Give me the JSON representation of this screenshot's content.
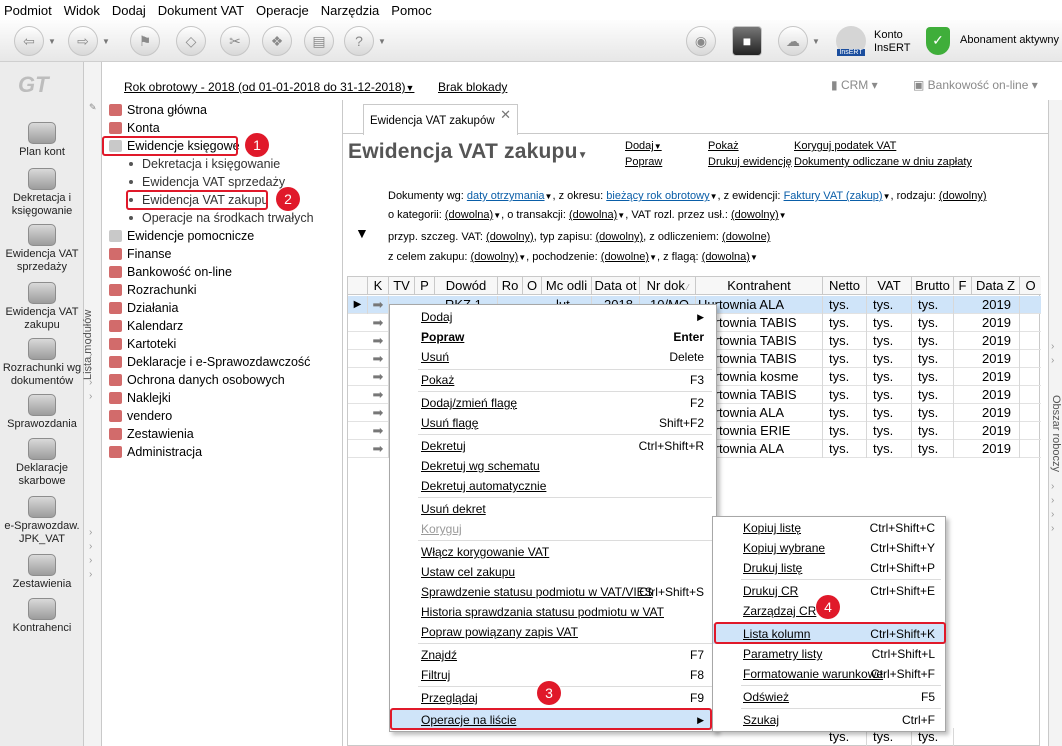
{
  "menubar": [
    "Podmiot",
    "Widok",
    "Dodaj",
    "Dokument VAT",
    "Operacje",
    "Narzędzia",
    "Pomoc"
  ],
  "toolbar": {
    "konto_line1": "Konto",
    "konto_line2": "InsERT",
    "abonament": "Abonament aktywny",
    "insert_logo": "InsERT"
  },
  "logo": "GT",
  "sidebar": [
    "Plan kont",
    "Dekretacja i księgowanie",
    "Ewidencja VAT sprzedaży",
    "Ewidencja VAT zakupu",
    "Rozrachunki wg dokumentów",
    "Sprawozdania",
    "Deklaracje skarbowe",
    "e-Sprawozdaw. JPK_VAT",
    "Zestawienia",
    "Kontrahenci"
  ],
  "lista_modulow": "Lista modułów",
  "yearbar": {
    "year": "Rok obrotowy - 2018  (od 01-01-2018 do 31-12-2018)",
    "blokada": "Brak blokady",
    "crm": "CRM",
    "bankowosc": "Bankowość on-line"
  },
  "tree": [
    {
      "label": "Strona główna"
    },
    {
      "label": "Konta"
    },
    {
      "label": "Ewidencje księgowe"
    },
    {
      "label": "Dekretacja i księgowanie"
    },
    {
      "label": "Ewidencja VAT sprzedaży"
    },
    {
      "label": "Ewidencja VAT zakupu"
    },
    {
      "label": "Operacje na środkach trwałych"
    },
    {
      "label": "Ewidencje pomocnicze"
    },
    {
      "label": "Finanse"
    },
    {
      "label": "Bankowość on-line"
    },
    {
      "label": "Rozrachunki"
    },
    {
      "label": "Działania"
    },
    {
      "label": "Kalendarz"
    },
    {
      "label": "Kartoteki"
    },
    {
      "label": "Deklaracje i e-Sprawozdawczość"
    },
    {
      "label": "Ochrona danych osobowych"
    },
    {
      "label": "Naklejki"
    },
    {
      "label": "vendero"
    },
    {
      "label": "Zestawienia"
    },
    {
      "label": "Administracja"
    }
  ],
  "tab_label": "Ewidencja VAT zakupów",
  "page_title": "Ewidencja VAT zakupu",
  "actions": {
    "dodaj": "Dodaj",
    "popraw": "Popraw",
    "pokaz": "Pokaż",
    "drukuj": "Drukuj ewidencję",
    "koryguj": "Koryguj podatek VAT",
    "dokumenty": "Dokumenty odliczane w dniu zapłaty"
  },
  "filters": {
    "l1_a": "Dokumenty wg:",
    "l1_b": "daty otrzymania",
    "l1_c": ", z okresu:",
    "l1_d": "bieżący rok obrotowy",
    "l1_e": ", z ewidencji:",
    "l1_f": "Faktury VAT (zakup)",
    "l1_g": ", rodzaju:",
    "l1_h": "(dowolny)",
    "l2_a": "o kategorii:",
    "l2_b": "(dowolna)",
    "l2_c": ", o transakcji:",
    "l2_d": "(dowolna)",
    "l2_e": ", VAT rozl. przez usł.:",
    "l2_f": "(dowolny)",
    "l3_a": "przyp. szczeg. VAT:",
    "l3_b": "(dowolny)",
    "l3_c": ", typ zapisu:",
    "l3_d": "(dowolny)",
    "l3_e": ", z odliczeniem:",
    "l3_f": "(dowolne)",
    "l4_a": "z celem zakupu:",
    "l4_b": "(dowolny)",
    "l4_c": ", pochodzenie:",
    "l4_d": "(dowolne)",
    "l4_e": ", z flagą:",
    "l4_f": "(dowolna)"
  },
  "grid": {
    "headers": [
      "K",
      "TV",
      "P",
      "Dowód",
      "Ro",
      "O",
      "Mc odli",
      "Data ot",
      "Nr dok",
      "Kontrahent",
      "Netto",
      "VAT",
      "Brutto",
      "F",
      "Data Z",
      "O"
    ],
    "rows": [
      {
        "kontrahent": "Hurtownia ALA",
        "netto": "tys.",
        "vat": "tys.",
        "brutto": "tys.",
        "data": "2019"
      },
      {
        "kontrahent": "Hurtownia TABIS",
        "netto": "tys.",
        "vat": "tys.",
        "brutto": "tys.",
        "data": "2019"
      },
      {
        "kontrahent": "Hurtownia TABIS",
        "netto": "tys.",
        "vat": "tys.",
        "brutto": "tys.",
        "data": "2019"
      },
      {
        "kontrahent": "Hurtownia TABIS",
        "netto": "tys.",
        "vat": "tys.",
        "brutto": "tys.",
        "data": "2019"
      },
      {
        "kontrahent": "Hurtownia kosme",
        "netto": "tys.",
        "vat": "tys.",
        "brutto": "tys.",
        "data": "2019"
      },
      {
        "kontrahent": "Hurtownia TABIS",
        "netto": "tys.",
        "vat": "tys.",
        "brutto": "tys.",
        "data": "2019"
      },
      {
        "kontrahent": "Hurtownia ALA",
        "netto": "tys.",
        "vat": "tys.",
        "brutto": "tys.",
        "data": "2019"
      },
      {
        "kontrahent": "Hurtownia ERIE",
        "netto": "tys.",
        "vat": "tys.",
        "brutto": "tys.",
        "data": "2019"
      },
      {
        "kontrahent": "Hurtownia ALA",
        "netto": "tys.",
        "vat": "tys.",
        "brutto": "tys.",
        "data": "2019"
      }
    ],
    "partial_row": {
      "dowod": "RKZ 1",
      "mc": "lut",
      "data_ot": "2018",
      "nr": "10/MO"
    },
    "bottom_vals": {
      "netto": "tys.",
      "vat": "tys.",
      "brutto": "tys."
    }
  },
  "obszar": "Obszar roboczy",
  "context_menu": [
    {
      "label": "Dodaj",
      "shortcut": ""
    },
    {
      "label": "Popraw",
      "shortcut": "Enter"
    },
    {
      "label": "Usuń",
      "shortcut": "Delete"
    },
    {
      "label": "Pokaż",
      "shortcut": "F3"
    },
    {
      "label": "Dodaj/zmień flagę",
      "shortcut": "F2"
    },
    {
      "label": "Usuń flagę",
      "shortcut": "Shift+F2"
    },
    {
      "label": "Dekretuj",
      "shortcut": "Ctrl+Shift+R"
    },
    {
      "label": "Dekretuj wg schematu",
      "shortcut": ""
    },
    {
      "label": "Dekretuj automatycznie",
      "shortcut": ""
    },
    {
      "label": "Usuń dekret",
      "shortcut": ""
    },
    {
      "label": "Koryguj",
      "shortcut": ""
    },
    {
      "label": "Włącz korygowanie VAT",
      "shortcut": ""
    },
    {
      "label": "Ustaw cel zakupu",
      "shortcut": ""
    },
    {
      "label": "Sprawdzenie statusu podmiotu w VAT/VIES",
      "shortcut": "Ctrl+Shift+S"
    },
    {
      "label": "Historia sprawdzania statusu podmiotu w VAT",
      "shortcut": ""
    },
    {
      "label": "Popraw powiązany zapis VAT",
      "shortcut": ""
    },
    {
      "label": "Znajdź",
      "shortcut": "F7"
    },
    {
      "label": "Filtruj",
      "shortcut": "F8"
    },
    {
      "label": "Przeglądaj",
      "shortcut": "F9"
    },
    {
      "label": "Operacje na liście",
      "shortcut": ""
    }
  ],
  "submenu": [
    {
      "label": "Kopiuj listę",
      "shortcut": "Ctrl+Shift+C"
    },
    {
      "label": "Kopiuj wybrane",
      "shortcut": "Ctrl+Shift+Y"
    },
    {
      "label": "Drukuj listę",
      "shortcut": "Ctrl+Shift+P"
    },
    {
      "label": "Drukuj CR",
      "shortcut": "Ctrl+Shift+E"
    },
    {
      "label": "Zarządzaj CR",
      "shortcut": ""
    },
    {
      "label": "Lista kolumn",
      "shortcut": "Ctrl+Shift+K"
    },
    {
      "label": "Parametry listy",
      "shortcut": "Ctrl+Shift+L"
    },
    {
      "label": "Formatowanie warunkowe",
      "shortcut": "Ctrl+Shift+F"
    },
    {
      "label": "Odśwież",
      "shortcut": "F5"
    },
    {
      "label": "Szukaj",
      "shortcut": "Ctrl+F"
    }
  ],
  "badges": [
    "1",
    "2",
    "3",
    "4"
  ]
}
